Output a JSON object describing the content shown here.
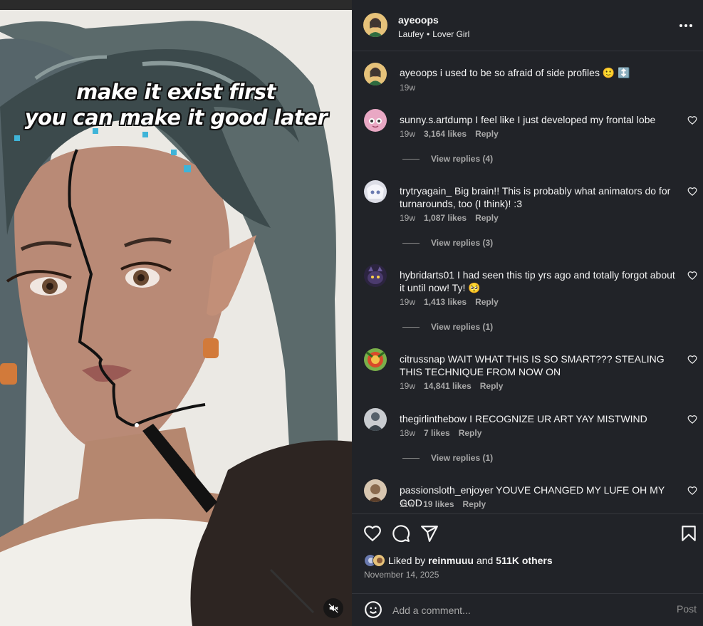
{
  "media": {
    "caption_line1": "make it exist first",
    "caption_line2": "you can make it good later",
    "mute_icon": "speaker-muted-icon"
  },
  "header": {
    "username": "ayeoops",
    "audio_artist": "Laufey",
    "separator": "•",
    "audio_track": "Lover Girl",
    "more_icon": "more-horizontal-icon"
  },
  "caption": {
    "username": "ayeoops",
    "text": "i used to be so afraid of side profiles 🙂 ↕️",
    "time": "19w"
  },
  "comments": [
    {
      "username": "sunny.s.artdump",
      "text": "I feel like I just developed my frontal lobe",
      "time": "19w",
      "likes": "3,164 likes",
      "reply": "Reply",
      "view_replies": "View replies (4)",
      "avatar_color": "#e9a8c4"
    },
    {
      "username": "trytryagain_",
      "text": "Big brain!! This is probably what animators do for turnarounds, too (I think)! :3",
      "time": "19w",
      "likes": "1,087 likes",
      "reply": "Reply",
      "view_replies": "View replies (3)",
      "avatar_color": "#dcdde6"
    },
    {
      "username": "hybridarts01",
      "text": "I had seen this tip yrs ago and totally forgot about it until now! Ty! 🥺",
      "time": "19w",
      "likes": "1,413 likes",
      "reply": "Reply",
      "view_replies": "View replies (1)",
      "avatar_color": "#4b3b6e"
    },
    {
      "username": "citrussnap",
      "text": "WAIT WHAT THIS IS SO SMART??? STEALING THIS TECHNIQUE FROM NOW ON",
      "time": "19w",
      "likes": "14,841 likes",
      "reply": "Reply",
      "view_replies": "",
      "avatar_color": "#5f8f2e"
    },
    {
      "username": "thegirlinthebow",
      "text": "I RECOGNIZE UR ART YAY MISTWIND",
      "time": "18w",
      "likes": "7 likes",
      "reply": "Reply",
      "view_replies": "View replies (1)",
      "avatar_color": "#55606a"
    },
    {
      "username": "passionsloth_enjoyer",
      "text": "YOUVE CHANGED MY LUFE OH MY GOD",
      "time": "11w",
      "likes": "19 likes",
      "reply": "Reply",
      "view_replies": "",
      "avatar_color": "#8a6a4e"
    }
  ],
  "actions": {
    "like_icon": "heart-icon",
    "comment_icon": "comment-bubble-icon",
    "share_icon": "send-paper-plane-icon",
    "save_icon": "bookmark-icon",
    "liked_by_prefix": "Liked by",
    "liked_by_user": "reinmuuu",
    "and": "and",
    "others": "511K others",
    "date": "November 14, 2025"
  },
  "add_comment": {
    "emoji_icon": "smiley-face-icon",
    "placeholder": "Add a comment...",
    "post_label": "Post"
  },
  "colors": {
    "panel_bg": "#212328",
    "divider": "#34363c",
    "muted_text": "#a8a8a8",
    "primary_text": "#f5f5f5"
  }
}
